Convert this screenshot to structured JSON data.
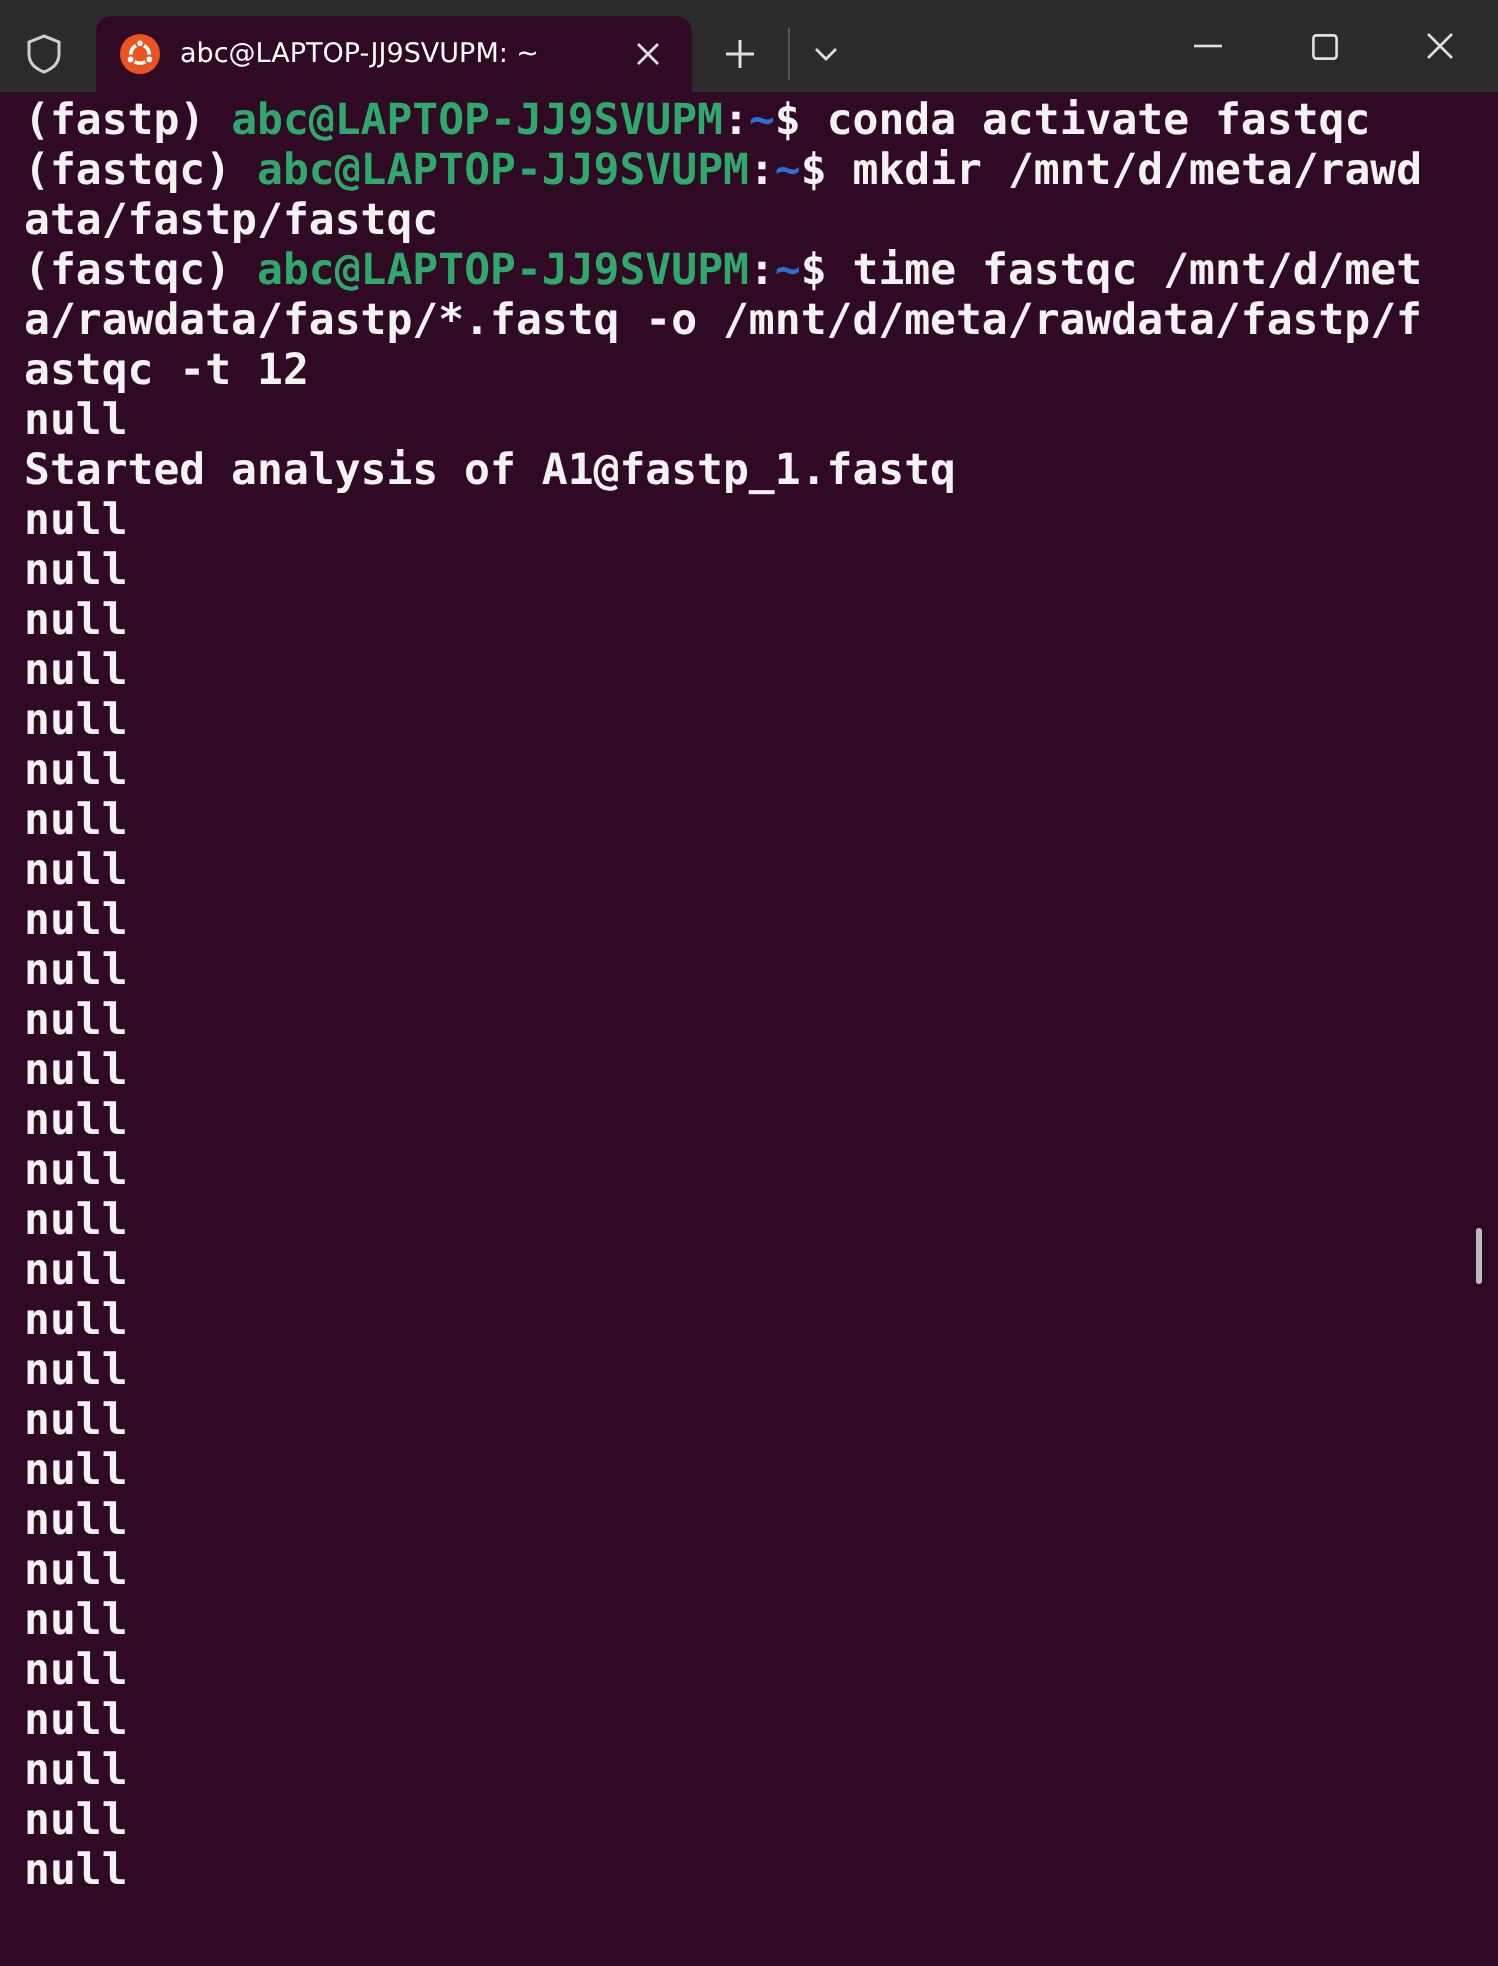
{
  "tab": {
    "title": "abc@LAPTOP-JJ9SVUPM: ~",
    "selected": true
  },
  "lines": [
    {
      "kind": "prompt",
      "env": "(fastp)",
      "user": "abc@LAPTOP-JJ9SVUPM",
      "sep": ":",
      "path": "~",
      "symbol": "$",
      "command": "conda activate fastqc"
    },
    {
      "kind": "prompt",
      "env": "(fastqc)",
      "user": "abc@LAPTOP-JJ9SVUPM",
      "sep": ":",
      "path": "~",
      "symbol": "$",
      "command": "mkdir /mnt/d/meta/rawd"
    },
    {
      "kind": "output",
      "text": "ata/fastp/fastqc"
    },
    {
      "kind": "prompt",
      "env": "(fastqc)",
      "user": "abc@LAPTOP-JJ9SVUPM",
      "sep": ":",
      "path": "~",
      "symbol": "$",
      "command": "time fastqc /mnt/d/met"
    },
    {
      "kind": "output",
      "text": "a/rawdata/fastp/*.fastq -o /mnt/d/meta/rawdata/fastp/f"
    },
    {
      "kind": "output",
      "text": "astqc -t 12"
    },
    {
      "kind": "output",
      "text": "null"
    },
    {
      "kind": "output",
      "text": "Started analysis of A1@fastp_1.fastq"
    },
    {
      "kind": "output",
      "text": "null"
    },
    {
      "kind": "output",
      "text": "null"
    },
    {
      "kind": "output",
      "text": "null"
    },
    {
      "kind": "output",
      "text": "null"
    },
    {
      "kind": "output",
      "text": "null"
    },
    {
      "kind": "output",
      "text": "null"
    },
    {
      "kind": "output",
      "text": "null"
    },
    {
      "kind": "output",
      "text": "null"
    },
    {
      "kind": "output",
      "text": "null"
    },
    {
      "kind": "output",
      "text": "null"
    },
    {
      "kind": "output",
      "text": "null"
    },
    {
      "kind": "output",
      "text": "null"
    },
    {
      "kind": "output",
      "text": "null"
    },
    {
      "kind": "output",
      "text": "null"
    },
    {
      "kind": "output",
      "text": "null"
    },
    {
      "kind": "output",
      "text": "null"
    },
    {
      "kind": "output",
      "text": "null"
    },
    {
      "kind": "output",
      "text": "null"
    },
    {
      "kind": "output",
      "text": "null"
    },
    {
      "kind": "output",
      "text": "null"
    },
    {
      "kind": "output",
      "text": "null"
    },
    {
      "kind": "output",
      "text": "null"
    },
    {
      "kind": "output",
      "text": "null"
    },
    {
      "kind": "output",
      "text": "null"
    },
    {
      "kind": "output",
      "text": "null"
    },
    {
      "kind": "output",
      "text": "null"
    },
    {
      "kind": "output",
      "text": "null"
    },
    {
      "kind": "output",
      "text": "null"
    }
  ]
}
